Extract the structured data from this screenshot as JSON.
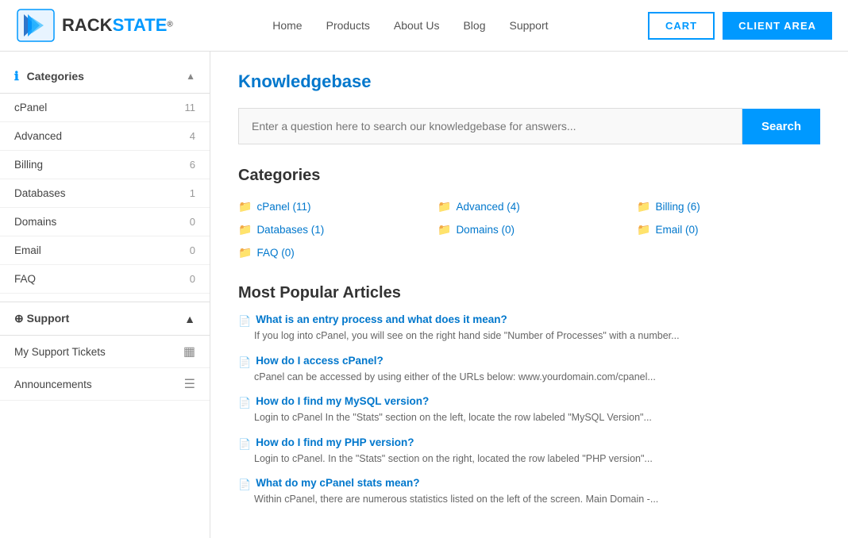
{
  "header": {
    "logo_rack": "RACK",
    "logo_state": "STATE",
    "logo_reg": "®",
    "nav": [
      {
        "label": "Home",
        "id": "home"
      },
      {
        "label": "Products",
        "id": "products"
      },
      {
        "label": "About Us",
        "id": "about"
      },
      {
        "label": "Blog",
        "id": "blog"
      },
      {
        "label": "Support",
        "id": "support"
      }
    ],
    "cart_label": "CART",
    "client_label": "CLIENT AREA"
  },
  "sidebar": {
    "categories_header": "Categories",
    "items": [
      {
        "label": "cPanel",
        "count": "11"
      },
      {
        "label": "Advanced",
        "count": "4"
      },
      {
        "label": "Billing",
        "count": "6"
      },
      {
        "label": "Databases",
        "count": "1"
      },
      {
        "label": "Domains",
        "count": "0"
      },
      {
        "label": "Email",
        "count": "0"
      },
      {
        "label": "FAQ",
        "count": "0"
      }
    ],
    "support_header": "Support",
    "support_items": [
      {
        "label": "My Support Tickets",
        "icon": "grid"
      },
      {
        "label": "Announcements",
        "icon": "list"
      }
    ]
  },
  "main": {
    "page_title": "Knowledgebase",
    "search_placeholder": "Enter a question here to search our knowledgebase for answers...",
    "search_button": "Search",
    "categories_title": "Categories",
    "categories": [
      {
        "label": "cPanel (11)",
        "col": 0
      },
      {
        "label": "Advanced (4)",
        "col": 1
      },
      {
        "label": "Billing (6)",
        "col": 2
      },
      {
        "label": "Databases (1)",
        "col": 0
      },
      {
        "label": "Domains (0)",
        "col": 1
      },
      {
        "label": "Email (0)",
        "col": 2
      },
      {
        "label": "FAQ (0)",
        "col": 0
      }
    ],
    "popular_title": "Most Popular Articles",
    "articles": [
      {
        "title": "What is an entry process and what does it mean?",
        "desc": "If you log into cPanel, you will see on the right hand side \"Number of Processes\" with a number..."
      },
      {
        "title": "How do I access cPanel?",
        "desc": "cPanel can be accessed by using either of the URLs below: www.yourdomain.com/cpanel..."
      },
      {
        "title": "How do I find my MySQL version?",
        "desc": "Login to cPanel In the \"Stats\" section on the left, locate the row labeled \"MySQL Version\"..."
      },
      {
        "title": "How do I find my PHP version?",
        "desc": "Login to cPanel. In the \"Stats\" section on the right, located the row labeled \"PHP version\"..."
      },
      {
        "title": "What do my cPanel stats mean?",
        "desc": "Within cPanel, there are numerous statistics listed on the left of the screen. Main Domain -..."
      }
    ]
  }
}
